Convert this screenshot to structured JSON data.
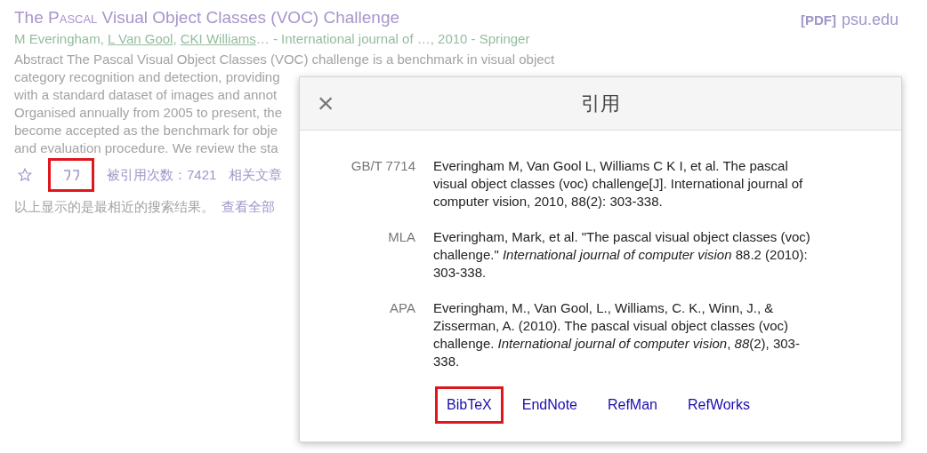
{
  "result": {
    "title_parts": [
      {
        "text": "The ",
        "kind": "plain"
      },
      {
        "text": "Pascal",
        "kind": "smallcaps"
      },
      {
        "text": " Visual Object Classes (VOC) Challenge",
        "kind": "plain"
      }
    ],
    "pdf_tag": "[PDF]",
    "pdf_source": "psu.edu",
    "authors": [
      {
        "text": "M Everingham",
        "link": false
      },
      {
        "text": ", ",
        "link": false
      },
      {
        "text": "L Van Gool",
        "link": true
      },
      {
        "text": ", ",
        "link": false
      },
      {
        "text": "CKI Williams",
        "link": true
      }
    ],
    "author_suffix": "… - International journal of …, 2010 - Springer",
    "abstract_lines": [
      "Abstract The Pascal Visual Object Classes (VOC) challenge is a benchmark in visual object",
      "category recognition and detection, providing",
      "with a standard dataset of images and annot",
      "Organised annually from 2005 to present, the",
      "become accepted as the benchmark for obje",
      "and evaluation procedure. We review the sta"
    ],
    "actions": [
      {
        "kind": "star",
        "highlighted": false
      },
      {
        "kind": "quote",
        "highlighted": true
      },
      {
        "kind": "link",
        "text": "被引用次数：7421"
      },
      {
        "kind": "link",
        "text": "相关文章"
      }
    ]
  },
  "footer": {
    "note": "以上显示的是最相近的搜索结果。",
    "link": "查看全部"
  },
  "dialog": {
    "title": "引用",
    "close": "×",
    "citations": [
      {
        "style": "GB/T 7714",
        "text": "Everingham M, Van Gool L, Williams C K I, et al. The pascal visual object classes (voc) challenge[J]. International journal of computer vision, 2010, 88(2): 303-338."
      },
      {
        "style": "MLA",
        "text": "Everingham, Mark, et al. \"The pascal visual object classes (voc) challenge.\" *International journal of computer vision* 88.2 (2010): 303-338."
      },
      {
        "style": "APA",
        "text": "Everingham, M., Van Gool, L., Williams, C. K., Winn, J., & Zisserman, A. (2010). The pascal visual object classes (voc) challenge. *International journal of computer vision*, *88*(2), 303-338."
      }
    ],
    "exports": [
      {
        "label": "BibTeX",
        "highlighted": true
      },
      {
        "label": "EndNote",
        "highlighted": false
      },
      {
        "label": "RefMan",
        "highlighted": false
      },
      {
        "label": "RefWorks",
        "highlighted": false
      }
    ]
  }
}
